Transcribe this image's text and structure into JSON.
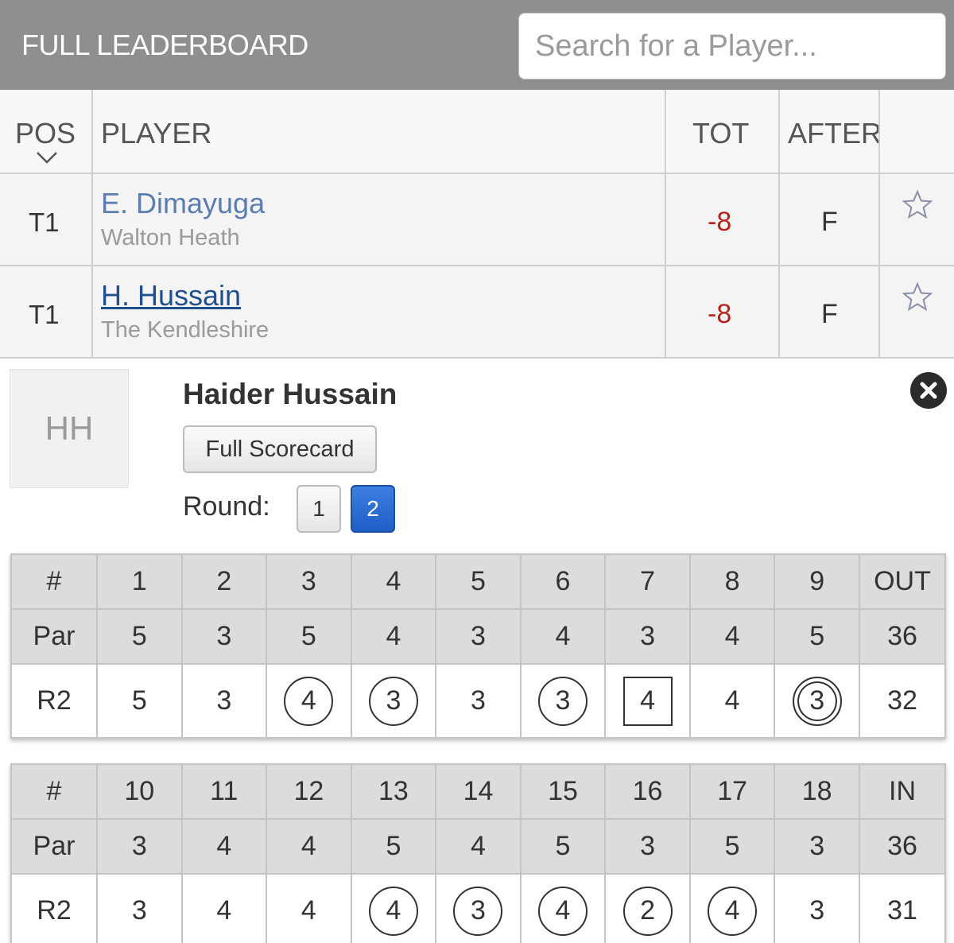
{
  "header": {
    "title": "FULL LEADERBOARD",
    "search_placeholder": "Search for a Player..."
  },
  "leaderboard": {
    "columns": {
      "pos": "POS",
      "player": "PLAYER",
      "tot": "TOT",
      "after": "AFTER"
    },
    "rows": [
      {
        "pos": "T1",
        "name": "E. Dimayuga",
        "club": "Walton Heath",
        "tot": "-8",
        "after": "F"
      },
      {
        "pos": "T1",
        "name": "H. Hussain",
        "club": "The Kendleshire",
        "tot": "-8",
        "after": "F"
      }
    ]
  },
  "detail": {
    "initials": "HH",
    "full_name": "Haider Hussain",
    "scorecard_button": "Full Scorecard",
    "round_label": "Round:",
    "rounds": [
      "1",
      "2"
    ],
    "active_round": "2"
  },
  "front_nine": {
    "header": [
      "#",
      "1",
      "2",
      "3",
      "4",
      "5",
      "6",
      "7",
      "8",
      "9",
      "OUT"
    ],
    "par": [
      "Par",
      "5",
      "3",
      "5",
      "4",
      "3",
      "4",
      "3",
      "4",
      "5",
      "36"
    ],
    "score": [
      "R2",
      "5",
      "3",
      "4",
      "3",
      "3",
      "3",
      "4",
      "4",
      "3",
      "32"
    ],
    "marks": [
      "",
      "",
      "",
      "birdie",
      "birdie",
      "",
      "birdie",
      "bogey",
      "",
      "eagle",
      ""
    ]
  },
  "back_nine": {
    "header": [
      "#",
      "10",
      "11",
      "12",
      "13",
      "14",
      "15",
      "16",
      "17",
      "18",
      "IN"
    ],
    "par": [
      "Par",
      "3",
      "4",
      "4",
      "5",
      "4",
      "5",
      "3",
      "5",
      "3",
      "36"
    ],
    "score": [
      "R2",
      "3",
      "4",
      "4",
      "4",
      "3",
      "4",
      "2",
      "4",
      "3",
      "31"
    ],
    "marks": [
      "",
      "",
      "",
      "",
      "birdie",
      "birdie",
      "birdie",
      "birdie",
      "birdie",
      "",
      ""
    ]
  },
  "colors": {
    "header_bg": "#8f8f8f",
    "over_par_red": "#b5231f",
    "link_blue": "#1f4f8f",
    "active_round_blue": "#1f5ec8"
  },
  "icons": [
    "chevron-down-icon",
    "star-icon",
    "close-icon"
  ]
}
